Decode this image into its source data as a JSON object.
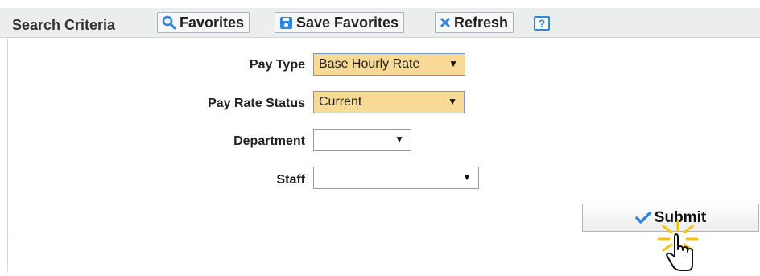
{
  "toolbar": {
    "title": "Search Criteria",
    "buttons": {
      "favorites": "Favorites",
      "save_favorites": "Save Favorites",
      "refresh": "Refresh"
    },
    "help": "?"
  },
  "form": {
    "pay_type": {
      "label": "Pay Type",
      "value": "Base Hourly Rate"
    },
    "pay_rate_status": {
      "label": "Pay Rate Status",
      "value": "Current"
    },
    "department": {
      "label": "Department",
      "value": ""
    },
    "staff": {
      "label": "Staff",
      "value": ""
    }
  },
  "submit": {
    "label": "Submit"
  },
  "colors": {
    "highlight_select": "#f8d995",
    "icon_blue": "#2e86de",
    "toolbar_bg": "#eceded"
  },
  "icons": [
    "search-icon",
    "save-icon",
    "close-icon",
    "help-icon",
    "checkmark-icon",
    "hand-pointer-icon"
  ]
}
